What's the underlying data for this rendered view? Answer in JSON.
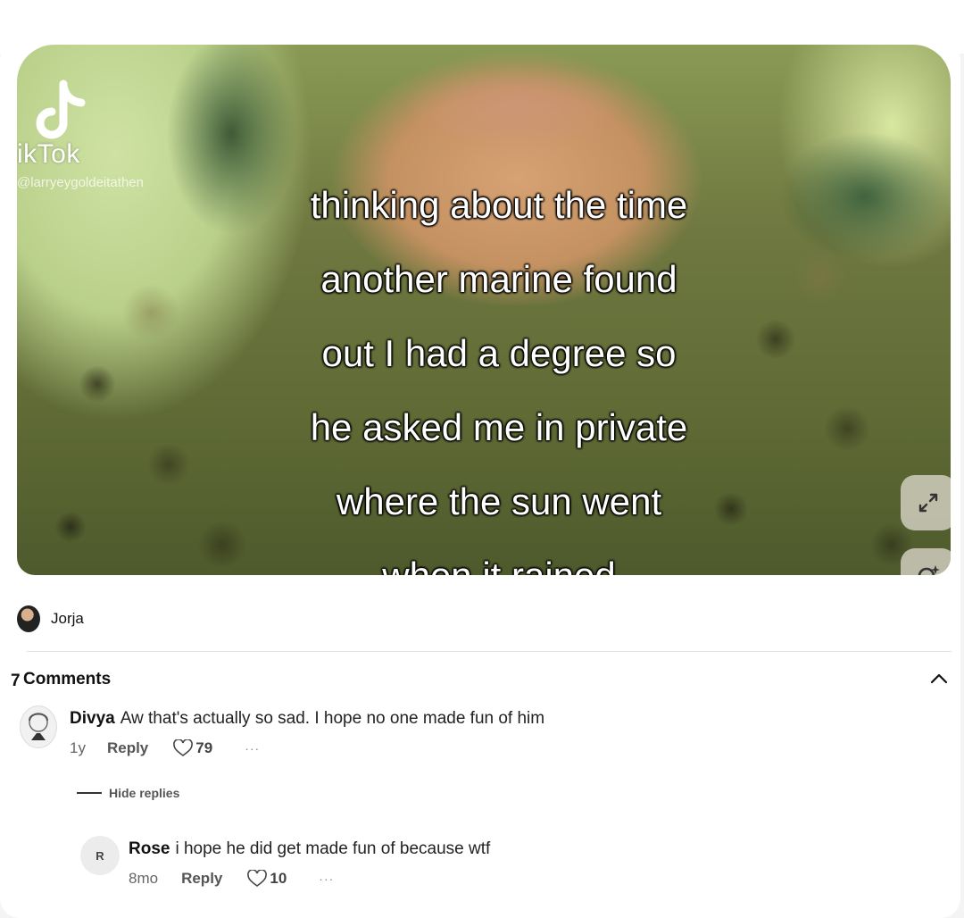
{
  "video": {
    "platform_name": "TikTok",
    "watermark_word": "ikTok",
    "watermark_handle": "@larryeygoldeitathen",
    "caption_lines": [
      "thinking about the time",
      "another marine found",
      "out I had a degree so",
      "he asked me in private",
      "where the sun went",
      "when it rained"
    ],
    "buttons": {
      "expand_icon": "expand-arrows-icon",
      "lens_icon": "visual-search-icon"
    }
  },
  "post": {
    "author": "Jorja"
  },
  "comments": {
    "header_prefix": "7",
    "title": "Comments",
    "collapse_icon": "chevron-up-icon",
    "items": [
      {
        "name": "Divya",
        "text": "Aw that's actually so sad. I hope no one made fun of him",
        "age": "1y",
        "reply_label": "Reply",
        "likes": "79",
        "more": "···",
        "hide_replies_label": "Hide replies",
        "replies": [
          {
            "initial": "R",
            "name": "Rose",
            "text": "i hope he did get made fun of because wtf",
            "age": "8mo",
            "reply_label": "Reply",
            "likes": "10",
            "more": "···"
          }
        ]
      }
    ]
  },
  "colors": {
    "accent_text": "#111111",
    "muted_text": "#666666",
    "divider": "#e3e3e3"
  }
}
